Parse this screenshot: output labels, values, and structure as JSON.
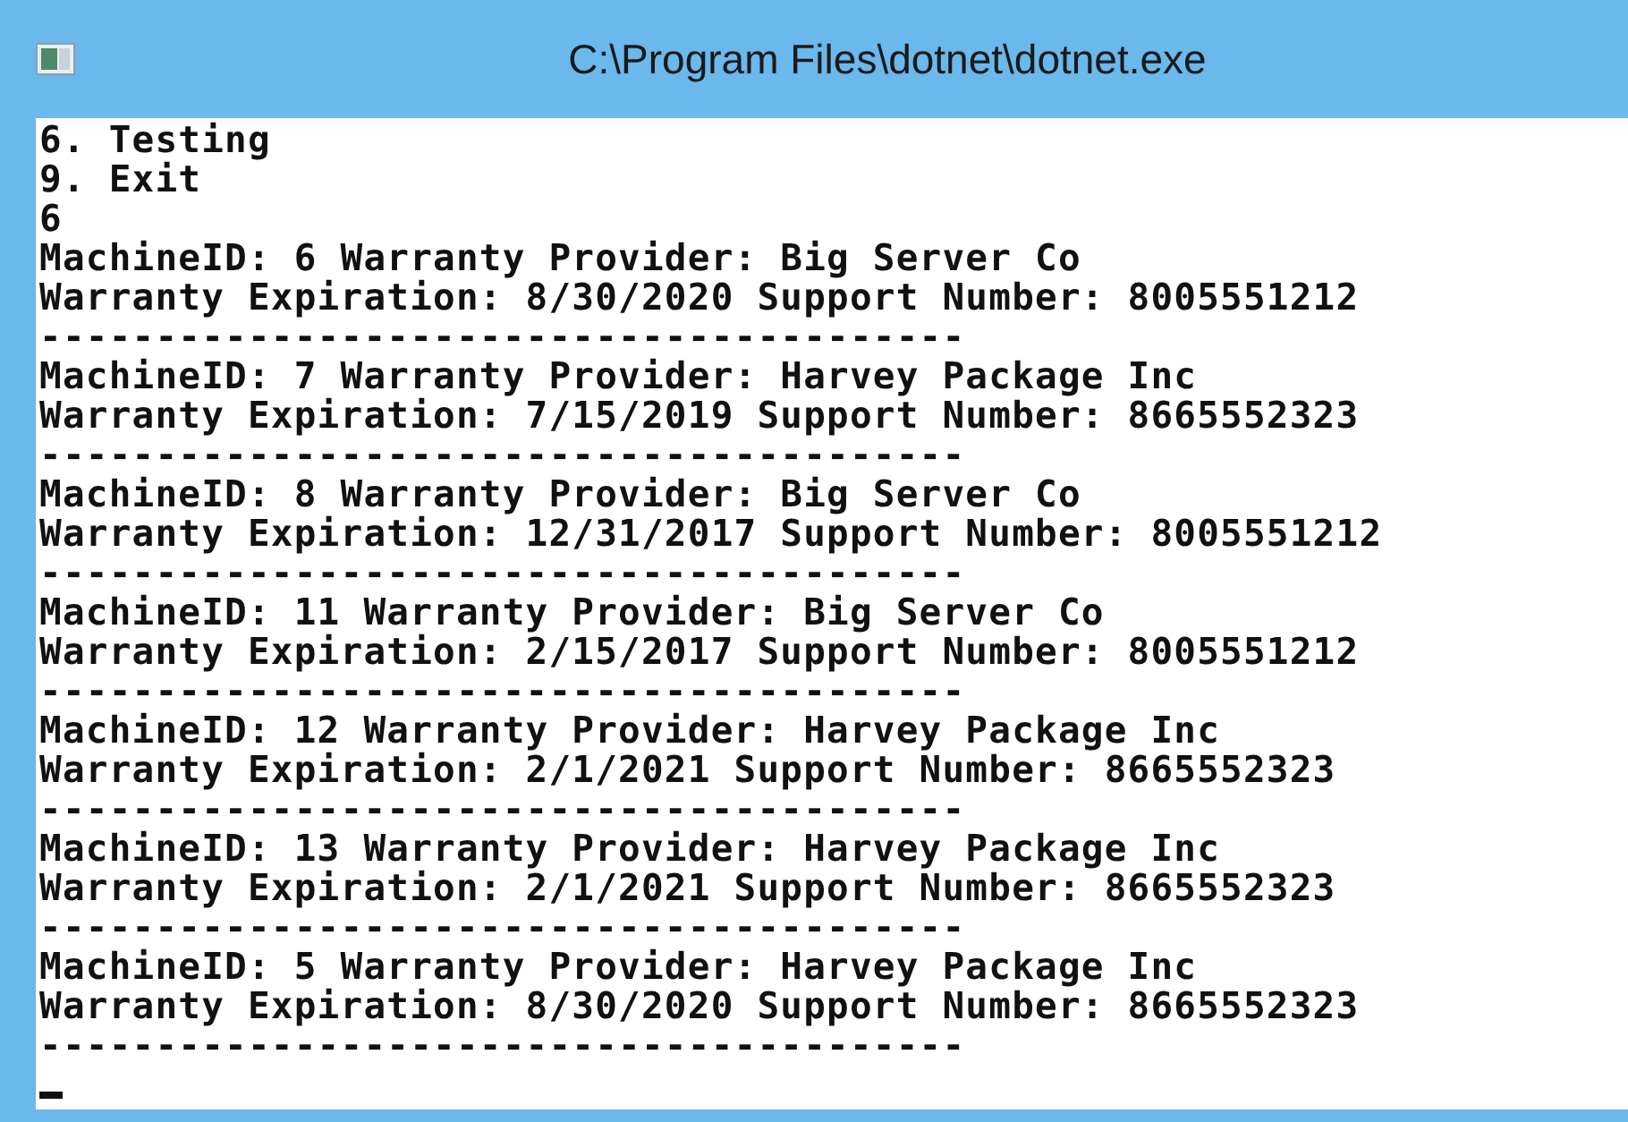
{
  "window": {
    "title": "C:\\Program Files\\dotnet\\dotnet.exe"
  },
  "console": {
    "lines": [
      "6. Testing",
      "9. Exit",
      "6",
      "MachineID: 6 Warranty Provider: Big Server Co",
      "Warranty Expiration: 8/30/2020 Support Number: 8005551212",
      "----------------------------------------",
      "MachineID: 7 Warranty Provider: Harvey Package Inc",
      "Warranty Expiration: 7/15/2019 Support Number: 8665552323",
      "----------------------------------------",
      "MachineID: 8 Warranty Provider: Big Server Co",
      "Warranty Expiration: 12/31/2017 Support Number: 8005551212",
      "----------------------------------------",
      "MachineID: 11 Warranty Provider: Big Server Co",
      "Warranty Expiration: 2/15/2017 Support Number: 8005551212",
      "----------------------------------------",
      "MachineID: 12 Warranty Provider: Harvey Package Inc",
      "Warranty Expiration: 2/1/2021 Support Number: 8665552323",
      "----------------------------------------",
      "MachineID: 13 Warranty Provider: Harvey Package Inc",
      "Warranty Expiration: 2/1/2021 Support Number: 8665552323",
      "----------------------------------------",
      "MachineID: 5 Warranty Provider: Harvey Package Inc",
      "Warranty Expiration: 8/30/2020 Support Number: 8665552323",
      "----------------------------------------"
    ]
  }
}
